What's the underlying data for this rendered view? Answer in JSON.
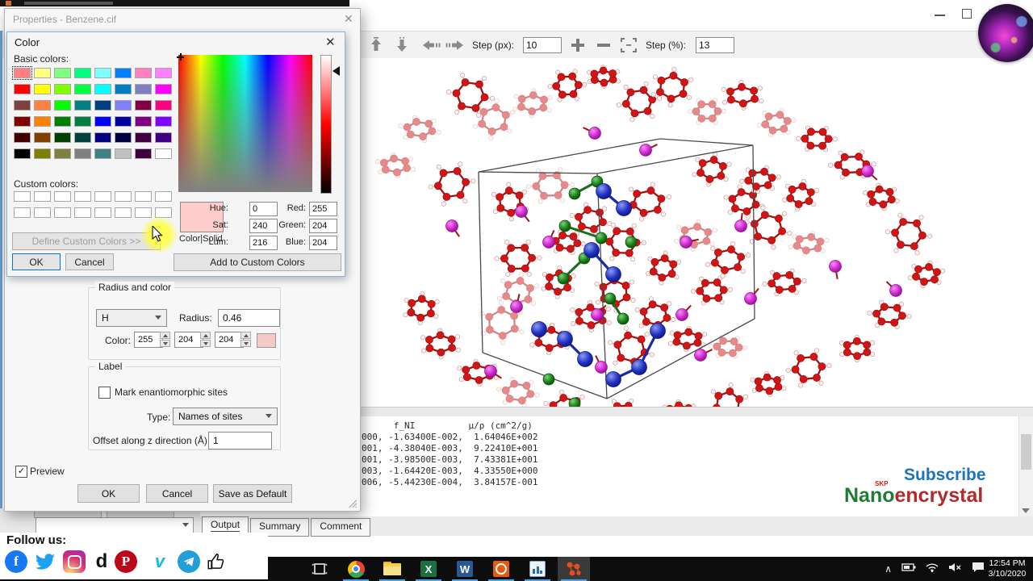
{
  "properties_dialog": {
    "title": "Properties - Benzene.cif",
    "close_glyph": "✕",
    "radius_color": {
      "legend": "Radius and color",
      "element_value": "H",
      "radius_label": "Radius:",
      "radius_value": "0.46",
      "color_label": "Color:",
      "rgb": [
        "255",
        "204",
        "204"
      ],
      "swatch_color": "#f6c9c9"
    },
    "label_group": {
      "legend": "Label",
      "mark_label": "Mark enantiomorphic sites",
      "mark_checked": false,
      "type_label": "Type:",
      "type_value": "Names of sites",
      "offset_label": "Offset along z direction (Å):",
      "offset_value": "1"
    },
    "preview_label": "Preview",
    "preview_checked": true,
    "check_glyph": "✓",
    "ok_label": "OK",
    "cancel_label": "Cancel",
    "save_default_label": "Save as Default"
  },
  "color_dialog": {
    "title": "Color",
    "close_glyph": "✕",
    "basic_colors_label": "Basic colors:",
    "basic_colors": [
      "#FF8080",
      "#FFFF80",
      "#80FF80",
      "#00FF80",
      "#80FFFF",
      "#0080FF",
      "#FF80C0",
      "#FF80FF",
      "#FF0000",
      "#FFFF00",
      "#80FF00",
      "#00FF40",
      "#00FFFF",
      "#0080C0",
      "#8080C0",
      "#FF00FF",
      "#804040",
      "#FF8040",
      "#00FF00",
      "#008080",
      "#004080",
      "#8080FF",
      "#800040",
      "#FF0080",
      "#800000",
      "#FF8000",
      "#008000",
      "#008040",
      "#0000FF",
      "#0000A0",
      "#800080",
      "#8000FF",
      "#400000",
      "#804000",
      "#004000",
      "#004040",
      "#000080",
      "#000040",
      "#400040",
      "#400080",
      "#000000",
      "#808000",
      "#808040",
      "#808080",
      "#408080",
      "#C0C0C0",
      "#400040",
      "#FFFFFF"
    ],
    "selected_index": 0,
    "custom_colors_label": "Custom colors:",
    "custom_colors_count": 16,
    "define_custom_label": "Define Custom Colors >>",
    "ok_label": "OK",
    "cancel_label": "Cancel",
    "color_solid_label": "Color|Solid",
    "preview_color": "#ffcccc",
    "fields": {
      "hue_label": "Hue:",
      "hue": "0",
      "sat_label": "Sat:",
      "sat": "240",
      "lum_label": "Lum:",
      "lum": "216",
      "red_label": "Red:",
      "red": "255",
      "green_label": "Green:",
      "green": "204",
      "blue_label": "Blue:",
      "blue": "204"
    },
    "add_custom_label": "Add to Custom Colors"
  },
  "toolbar": {
    "step_px_label": "Step (px):",
    "step_px_value": "10",
    "step_pct_label": "Step (%):",
    "step_pct_value": "13"
  },
  "output_panel": {
    "lines": [
      "      f_NI          µ/ρ (cm^2/g)",
      "000, -1.63400E-002,  1.64046E+002",
      "001, -4.38040E-003,  9.22410E+001",
      "001, -3.98500E-003,  7.43381E+001",
      "003, -1.64420E-003,  4.33550E+000",
      "006, -5.44230E-004,  3.84157E-001"
    ],
    "tabs": [
      "Output",
      "Summary",
      "Comment"
    ],
    "active_tab": "Output"
  },
  "overlays": {
    "subscribe": {
      "subscribe_text": "Subscribe",
      "skp_text": "SKP",
      "nano_text": "Nano",
      "encrystal_text": "encrystal",
      "subscribe_color": "#1b74bc",
      "nano_color": "#1e7d32",
      "encrystal_color": "#b22a2a"
    },
    "follow": {
      "label": "Follow us:",
      "icons": [
        "facebook",
        "twitter",
        "instagram",
        "dailymotion",
        "pinterest",
        "vimeo",
        "telegram",
        "thumbs-up"
      ]
    }
  },
  "taskbar": {
    "apps": [
      "task-view",
      "chrome",
      "file-explorer",
      "spreadsheet",
      "word-doc",
      "recorder",
      "presentation",
      "vesta"
    ],
    "active_app": "vesta",
    "time": "12:54 PM",
    "date": "3/10/2020"
  },
  "viewport": {
    "cell_edge_color": "#4a4a4a",
    "atom_colors": {
      "carbon": "#d31414",
      "carbon_bond": "#a51111",
      "hydrogen": "#faf1f0",
      "hydrogen_edge": "#cf9e9e",
      "blue_atom": "#1425b8",
      "green_atom": "#127012",
      "magenta_atom": "#c21ec2"
    }
  }
}
